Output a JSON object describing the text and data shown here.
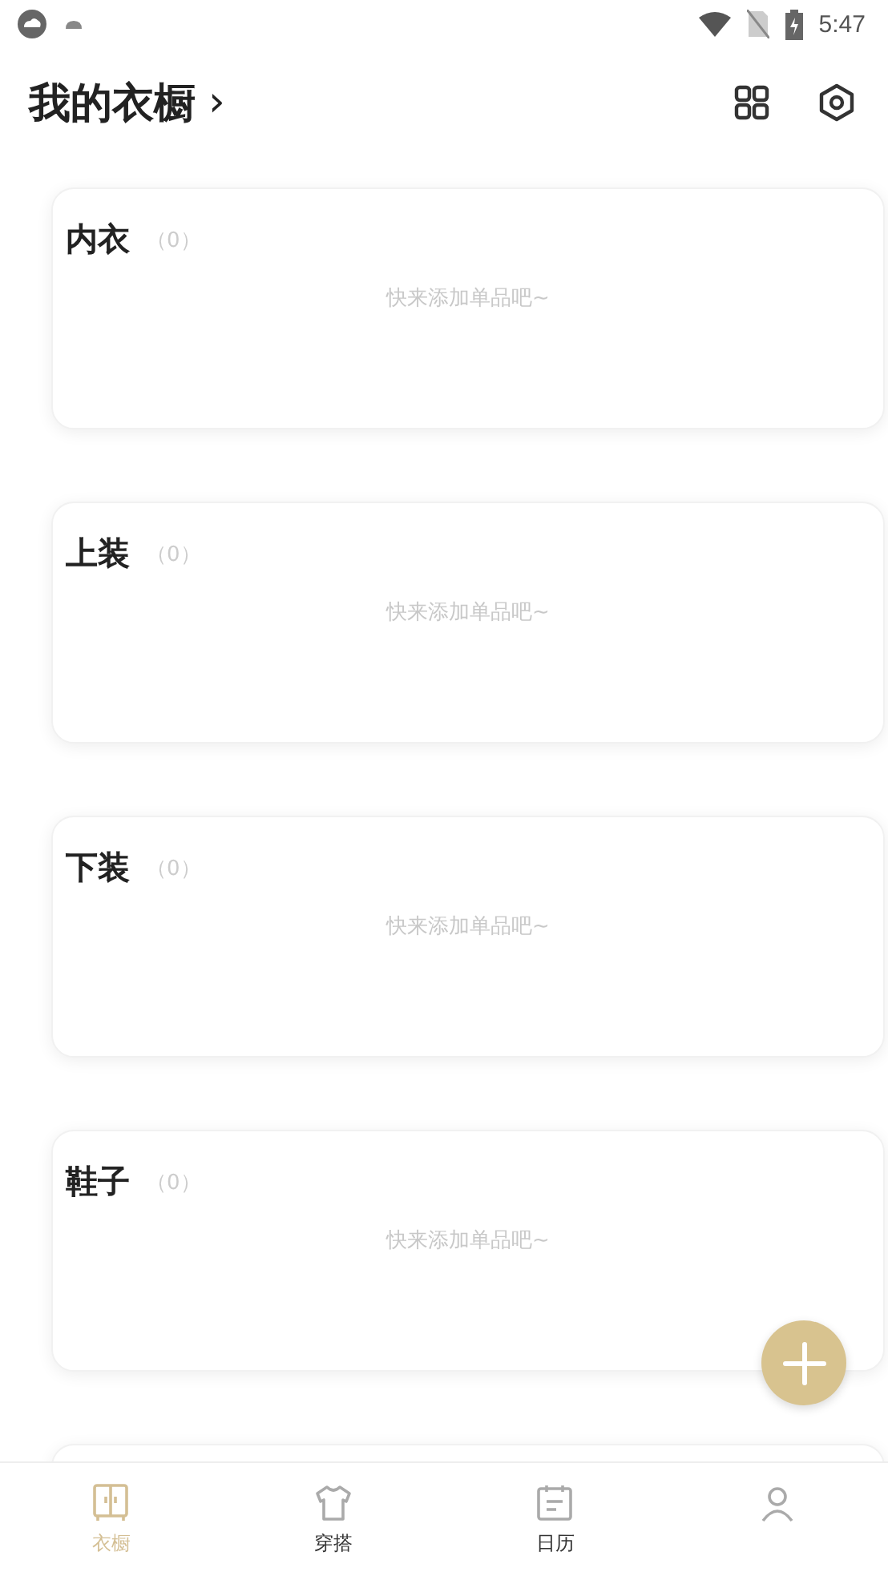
{
  "status_bar": {
    "time": "5:47"
  },
  "header": {
    "title": "我的衣橱",
    "chevron": "›"
  },
  "categories": [
    {
      "name": "内衣",
      "count": "（0）",
      "empty_hint": "快来添加单品吧~"
    },
    {
      "name": "上装",
      "count": "（0）",
      "empty_hint": "快来添加单品吧~"
    },
    {
      "name": "下装",
      "count": "（0）",
      "empty_hint": "快来添加单品吧~"
    },
    {
      "name": "鞋子",
      "count": "（0）",
      "empty_hint": "快来添加单品吧~"
    }
  ],
  "tabs": [
    {
      "kind": "wardrobe",
      "label": "衣橱",
      "selected": true
    },
    {
      "kind": "outfit",
      "label": "穿搭",
      "selected": false
    },
    {
      "kind": "calendar",
      "label": "日历",
      "selected": false
    },
    {
      "kind": "profile",
      "selected": false
    }
  ]
}
